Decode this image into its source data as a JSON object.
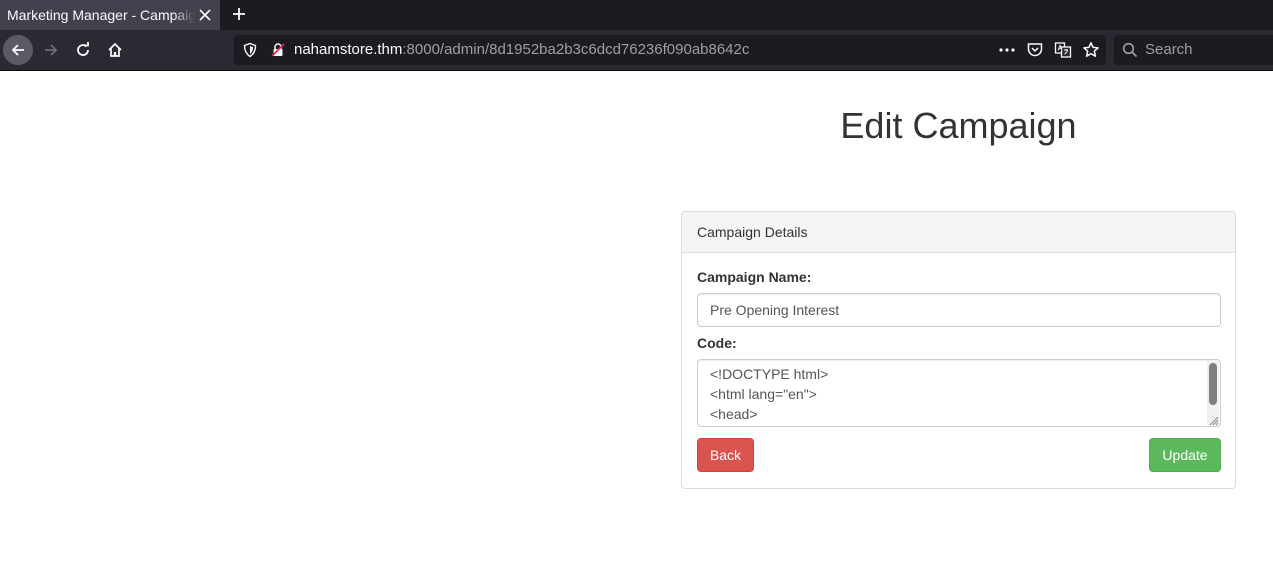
{
  "browser": {
    "tab": {
      "title": "Marketing Manager - Campaign"
    },
    "url": {
      "host": "nahamstore.thm",
      "path": ":8000/admin/8d1952ba2b3c6dcd76236f090ab8642c"
    },
    "search": {
      "placeholder": "Search"
    },
    "icons": [
      "close-icon",
      "plus-icon",
      "back-arrow-icon",
      "forward-arrow-icon",
      "reload-icon",
      "home-icon",
      "shield-icon",
      "insecure-lock-icon",
      "more-icon",
      "pocket-icon",
      "translate-icon",
      "bookmark-star-icon",
      "search-icon"
    ]
  },
  "page": {
    "title": "Edit Campaign",
    "panel": {
      "heading": "Campaign Details",
      "name_label": "Campaign Name:",
      "name_value": "Pre Opening Interest",
      "code_label": "Code:",
      "code_lines": [
        "<!DOCTYPE html>",
        "<html lang=\"en\">",
        "<head>"
      ],
      "back_label": "Back",
      "update_label": "Update"
    }
  },
  "colors": {
    "danger": "#d9534f",
    "success": "#5cb85c",
    "chrome_dark": "#1c1b22",
    "chrome_toolbar": "#2b2a33"
  }
}
